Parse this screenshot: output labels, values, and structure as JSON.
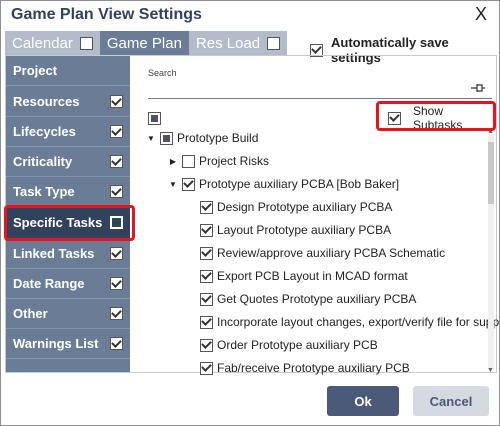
{
  "dialog": {
    "title": "Game Plan View Settings",
    "close_label": "X"
  },
  "tabs": [
    {
      "label": "Calendar",
      "active": false,
      "has_checkbox": true,
      "checked": false
    },
    {
      "label": "Game Plan",
      "active": true,
      "has_checkbox": false
    },
    {
      "label": "Res Load",
      "active": false,
      "has_checkbox": true,
      "checked": false
    }
  ],
  "auto_save": {
    "label": "Automatically save settings",
    "checked": true
  },
  "sidebar": {
    "items": [
      {
        "label": "Project",
        "checked": null
      },
      {
        "label": "Resources",
        "checked": true
      },
      {
        "label": "Lifecycles",
        "checked": true
      },
      {
        "label": "Criticality",
        "checked": true
      },
      {
        "label": "Task Type",
        "checked": true
      },
      {
        "label": "Specific Tasks",
        "checked": false,
        "active": true
      },
      {
        "label": "Linked Tasks",
        "checked": true
      },
      {
        "label": "Date Range",
        "checked": true
      },
      {
        "label": "Other",
        "checked": true
      },
      {
        "label": "Warnings List",
        "checked": true
      }
    ]
  },
  "search": {
    "label": "Search",
    "value": "",
    "placeholder": ""
  },
  "show_subtasks": {
    "label": "Show Subtasks",
    "checked": true
  },
  "tree": {
    "root_checkbox": "partial",
    "prototype_build": {
      "label": "Prototype Build",
      "expanded": true,
      "state": "partial"
    },
    "project_risks": {
      "label": "Project Risks",
      "expanded": false,
      "state": "unchecked"
    },
    "auxiliary_pcba": {
      "label": "Prototype auxiliary PCBA [Bob Baker]",
      "expanded": true,
      "state": "checked"
    },
    "tasks": [
      "Design Prototype auxiliary PCBA",
      "Layout Prototype auxiliary PCBA",
      "Review/approve auxiliary PCBA Schematic",
      "Export PCB Layout in MCAD format",
      "Get Quotes Prototype auxiliary PCBA",
      "Incorporate layout changes, export/verify file for supplier",
      "Order Prototype auxiliary PCB",
      "Fab/receive Prototype auxiliary PCB"
    ]
  },
  "footer": {
    "ok_label": "Ok",
    "cancel_label": "Cancel"
  },
  "colors": {
    "sidebar": "#6b7c96",
    "active_item": "#33425c",
    "highlight": "#e8141c",
    "ok_button": "#4a5a78"
  },
  "icons": {
    "pin": "pin-icon",
    "expand": "triangle-right-icon",
    "collapse": "triangle-down-icon"
  }
}
